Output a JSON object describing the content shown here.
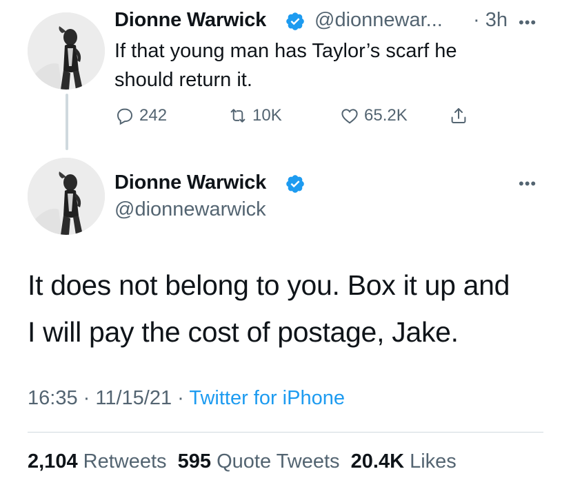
{
  "parent_tweet": {
    "name": "Dionne Warwick",
    "handle": "@dionnewar...",
    "time": "· 3h",
    "text_line1": "If that young man has Taylor’s scarf he",
    "text_line2": "should return it.",
    "replies": "242",
    "retweets": "10K",
    "likes": "65.2K"
  },
  "main_tweet": {
    "name": "Dionne Warwick",
    "handle": "@dionnewarwick",
    "text_line1": "It does not belong to you. Box it up and",
    "text_line2": "I will pay the cost of postage, Jake.",
    "time": "16:35 · 11/15/21 · ",
    "source": "Twitter for iPhone",
    "retweets_count": "2,104",
    "retweets_label": "Retweets",
    "quotes_count": "595",
    "quotes_label": "Quote Tweets",
    "likes_count": "20.4K",
    "likes_label": "Likes"
  },
  "icons": {
    "verified": "verified-badge-icon",
    "reply": "reply-icon",
    "retweet": "retweet-icon",
    "like": "heart-icon",
    "share": "share-icon",
    "more": "more-icon"
  },
  "colors": {
    "accent": "#1d9bf0",
    "secondary_text": "#536471",
    "primary_text": "#0f1419",
    "divider": "#cfd9de"
  }
}
